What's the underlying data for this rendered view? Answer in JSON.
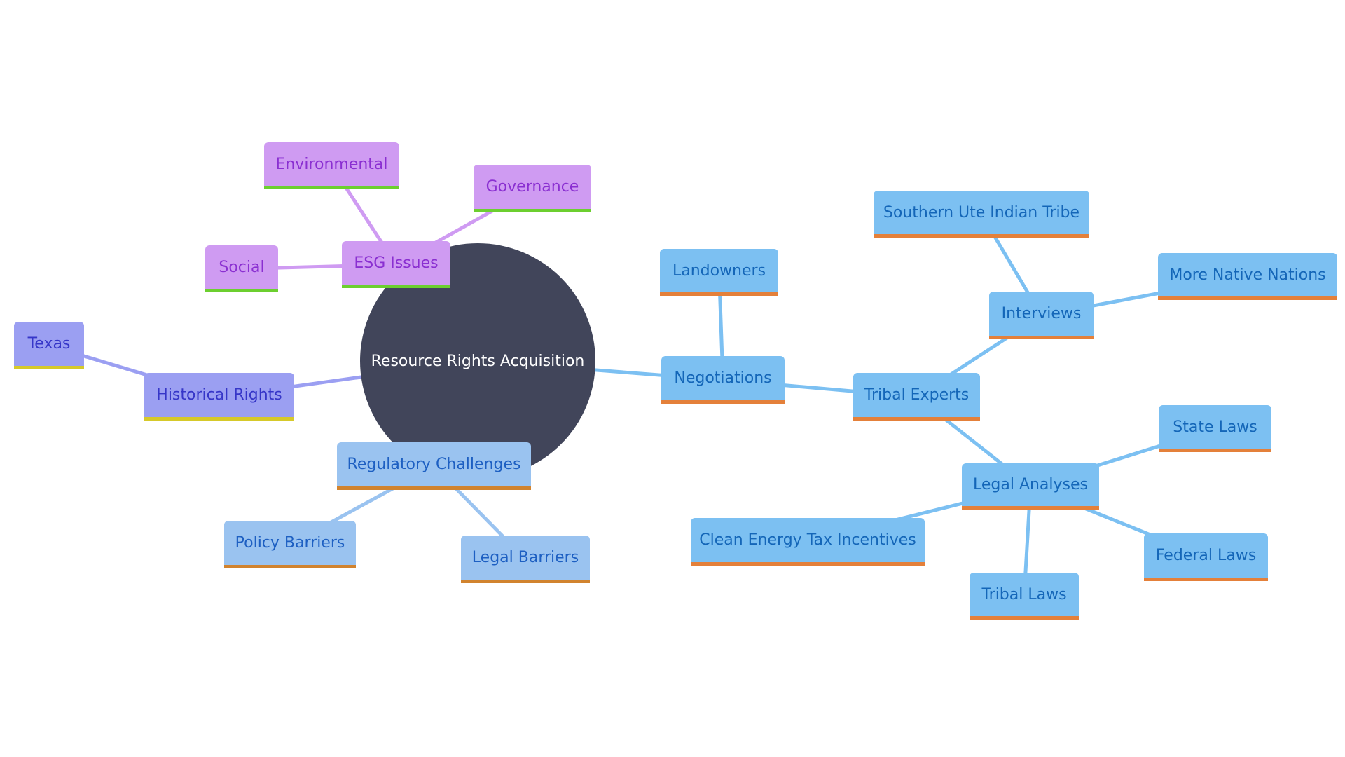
{
  "title": "Resource Rights Acquisition",
  "colors": {
    "root_fill": "#41455a",
    "esg_branch": "#cf9bf2",
    "historical_branch": "#9b9ff2",
    "regulatory_branch": "#9ac3f0",
    "negotiations_branch": "#7cc0f2"
  },
  "root": {
    "id": "root",
    "label": "Resource Rights Acquisition"
  },
  "nodes": [
    {
      "id": "esg",
      "label": "ESG Issues",
      "parent": "root",
      "style": "purple"
    },
    {
      "id": "environmental",
      "label": "Environmental",
      "parent": "esg",
      "style": "purple"
    },
    {
      "id": "governance",
      "label": "Governance",
      "parent": "esg",
      "style": "purple"
    },
    {
      "id": "social",
      "label": "Social",
      "parent": "esg",
      "style": "purple"
    },
    {
      "id": "historical",
      "label": "Historical Rights",
      "parent": "root",
      "style": "indigo"
    },
    {
      "id": "texas",
      "label": "Texas",
      "parent": "historical",
      "style": "indigo"
    },
    {
      "id": "regulatory",
      "label": "Regulatory Challenges",
      "parent": "root",
      "style": "lightblue"
    },
    {
      "id": "policy",
      "label": "Policy Barriers",
      "parent": "regulatory",
      "style": "lightblue"
    },
    {
      "id": "legalbarriers",
      "label": "Legal Barriers",
      "parent": "regulatory",
      "style": "lightblue"
    },
    {
      "id": "negotiations",
      "label": "Negotiations",
      "parent": "root",
      "style": "skyblue"
    },
    {
      "id": "landowners",
      "label": "Landowners",
      "parent": "negotiations",
      "style": "skyblue"
    },
    {
      "id": "tribal",
      "label": "Tribal Experts",
      "parent": "negotiations",
      "style": "skyblue"
    },
    {
      "id": "interviews",
      "label": "Interviews",
      "parent": "tribal",
      "style": "skyblue"
    },
    {
      "id": "southernute",
      "label": "Southern Ute Indian Tribe",
      "parent": "interviews",
      "style": "skyblue"
    },
    {
      "id": "morenative",
      "label": "More Native Nations",
      "parent": "interviews",
      "style": "skyblue"
    },
    {
      "id": "legalanalyses",
      "label": "Legal Analyses",
      "parent": "tribal",
      "style": "skyblue"
    },
    {
      "id": "statelaws",
      "label": "State Laws",
      "parent": "legalanalyses",
      "style": "skyblue"
    },
    {
      "id": "federallaws",
      "label": "Federal Laws",
      "parent": "legalanalyses",
      "style": "skyblue"
    },
    {
      "id": "triballaws",
      "label": "Tribal Laws",
      "parent": "legalanalyses",
      "style": "skyblue"
    },
    {
      "id": "cleanenergy",
      "label": "Clean Energy Tax Incentives",
      "parent": "legalanalyses",
      "style": "skyblue"
    }
  ]
}
